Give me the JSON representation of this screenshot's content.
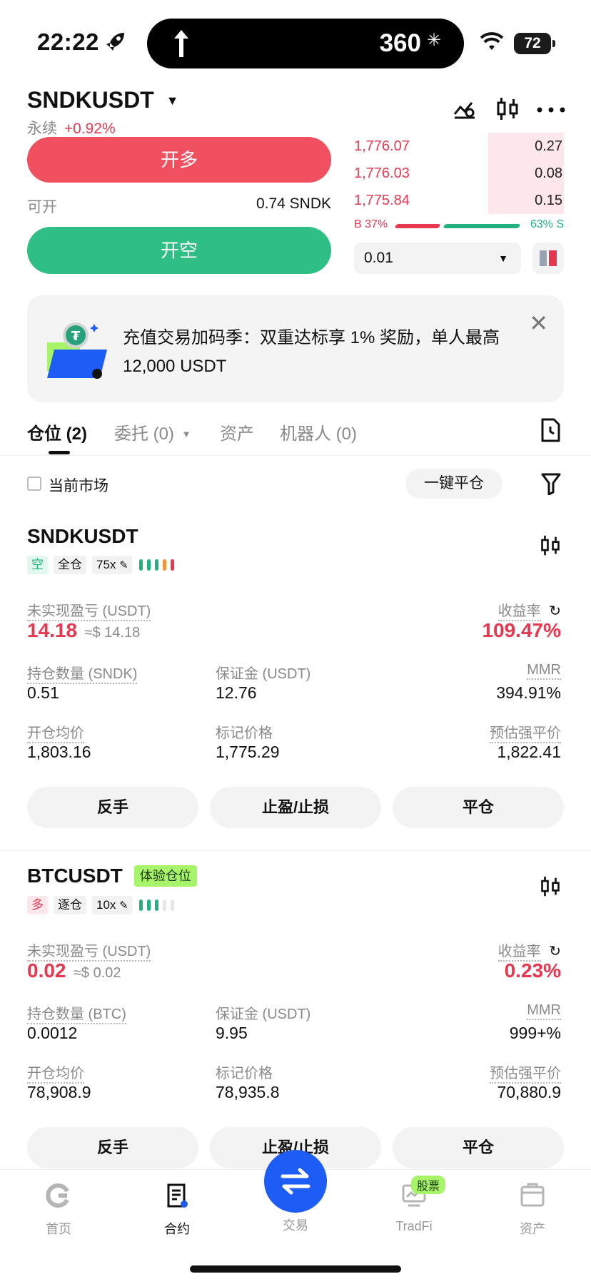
{
  "status_bar": {
    "time": "22:22",
    "island_number": "360",
    "battery": "72"
  },
  "header": {
    "pair": "SNDKUSDT",
    "contract_type": "永续",
    "change": "+0.92%"
  },
  "order": {
    "long_label": "开多",
    "available_label": "可开",
    "available_value": "0.74 SNDK",
    "short_label": "开空"
  },
  "orderbook": {
    "rows": [
      {
        "price": "1,776.07",
        "qty": "0.27"
      },
      {
        "price": "1,776.03",
        "qty": "0.08"
      },
      {
        "price": "1,775.84",
        "qty": "0.15"
      }
    ],
    "buy_ratio": "B 37%",
    "sell_ratio": "63% S",
    "step": "0.01"
  },
  "banner": {
    "text": "充值交易加码季：双重达标享 1% 奖励，单人最高 12,000 USDT"
  },
  "tabs": [
    {
      "label": "仓位 (2)"
    },
    {
      "label": "委托 (0)"
    },
    {
      "label": "资产"
    },
    {
      "label": "机器人 (0)"
    }
  ],
  "filter": {
    "market_label": "当前市场",
    "close_all": "一键平仓"
  },
  "positions": [
    {
      "symbol": "SNDKUSDT",
      "side": "空",
      "margin_mode": "全仓",
      "leverage": "75x",
      "pnl_label": "未实现盈亏 (USDT)",
      "pnl": "14.18",
      "pnl_usd": "≈$ 14.18",
      "roe_label": "收益率",
      "roe": "109.47%",
      "qty_label": "持仓数量 (SNDK)",
      "qty": "0.51",
      "margin_label": "保证金 (USDT)",
      "margin": "12.76",
      "mmr_label": "MMR",
      "mmr": "394.91%",
      "entry_label": "开仓均价",
      "entry": "1,803.16",
      "mark_label": "标记价格",
      "mark": "1,775.29",
      "liq_label": "预估强平价",
      "liq": "1,822.41",
      "btn_reverse": "反手",
      "btn_tpsl": "止盈/止损",
      "btn_close": "平仓"
    },
    {
      "symbol": "BTCUSDT",
      "badge": "体验仓位",
      "side": "多",
      "margin_mode": "逐仓",
      "leverage": "10x",
      "pnl_label": "未实现盈亏 (USDT)",
      "pnl": "0.02",
      "pnl_usd": "≈$ 0.02",
      "roe_label": "收益率",
      "roe": "0.23%",
      "qty_label": "持仓数量 (BTC)",
      "qty": "0.0012",
      "margin_label": "保证金 (USDT)",
      "margin": "9.95",
      "mmr_label": "MMR",
      "mmr": "999+%",
      "entry_label": "开仓均价",
      "entry": "78,908.9",
      "mark_label": "标记价格",
      "mark": "78,935.8",
      "liq_label": "预估强平价",
      "liq": "70,880.9",
      "btn_reverse": "反手",
      "btn_tpsl": "止盈/止损",
      "btn_close": "平仓"
    }
  ],
  "nav": {
    "items": [
      {
        "label": "首页",
        "icon": "home-icon"
      },
      {
        "label": "合约",
        "icon": "contract-icon"
      },
      {
        "label": "交易",
        "icon": "swap-icon"
      },
      {
        "label": "TradFi",
        "icon": "tradfi-icon",
        "badge": "股票"
      },
      {
        "label": "资产",
        "icon": "wallet-icon"
      }
    ]
  }
}
